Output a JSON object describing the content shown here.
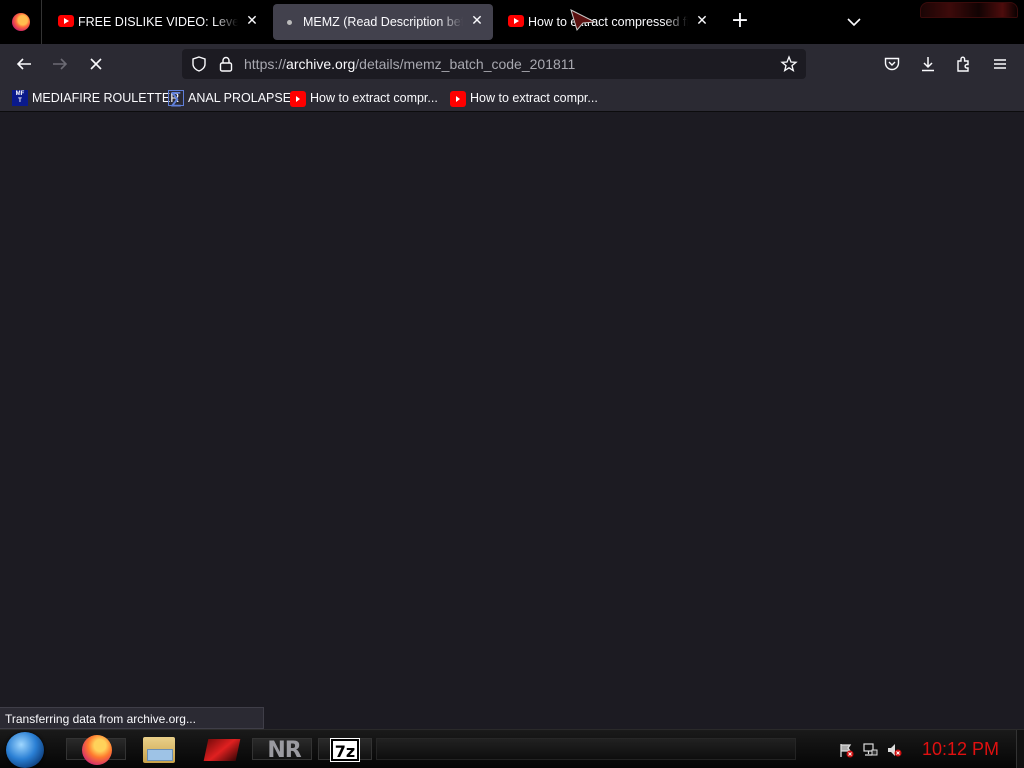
{
  "tabs": [
    {
      "title": "FREE DISLIKE VIDEO: Level Fail C",
      "icon": "youtube-icon",
      "selected": false
    },
    {
      "title": "MEMZ (Read Description before",
      "icon": "loading-dot-icon",
      "selected": true
    },
    {
      "title": "How to extract compressed file",
      "icon": "youtube-icon",
      "selected": false
    }
  ],
  "navigation": {
    "url_scheme": "https://",
    "url_host": "archive.org",
    "url_path": "/details/memz_batch_code_201811"
  },
  "bookmarks": [
    {
      "label": "MEDIAFIRE ROULETTER",
      "icon": "mediafire-icon"
    },
    {
      "label": "ANAL PROLAPSE",
      "icon": "sigma-icon"
    },
    {
      "label": "How to extract compr...",
      "icon": "youtube-icon"
    },
    {
      "label": "How to extract compr...",
      "icon": "youtube-icon"
    }
  ],
  "status": {
    "text": "Transferring data from archive.org..."
  },
  "taskbar": {
    "items": [
      "firefox-icon",
      "file-explorer-icon",
      "red-app-icon",
      "nr-icon",
      "7zip-icon"
    ],
    "sevenzip_label": "7z",
    "nr_label": "NR",
    "clock": "10:12 PM"
  },
  "colors": {
    "toolbar": "#2b2a33",
    "content": "#1c1b22",
    "clock": "#e01010"
  }
}
